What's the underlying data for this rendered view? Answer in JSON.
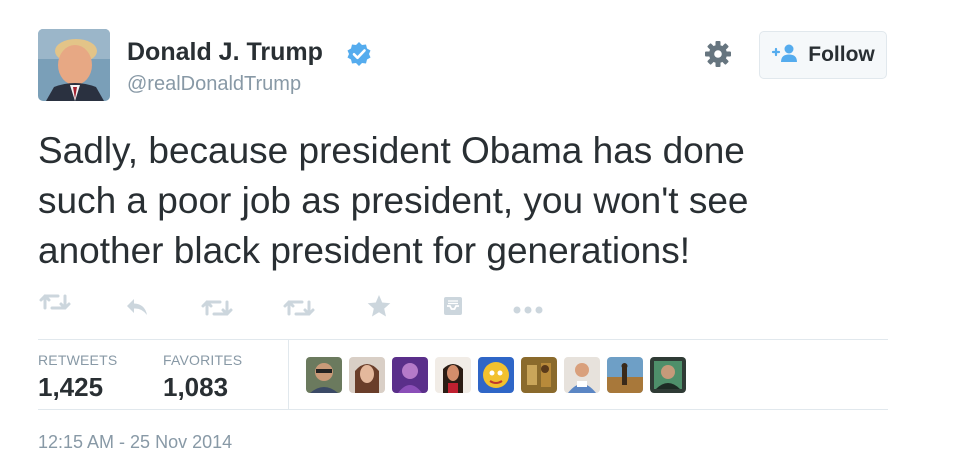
{
  "author": {
    "name": "Donald J. Trump",
    "handle": "@realDonaldTrump",
    "verified_icon": "verified-badge-icon"
  },
  "follow_button": {
    "label": "Follow",
    "icon": "follow-person-plus-icon"
  },
  "settings_icon": "gear-icon",
  "tweet": {
    "text": "Sadly, because president Obama has done\nsuch a poor job as president, you won't see\nanother black president for generations!"
  },
  "actions": [
    "retweet-icon",
    "reply-icon",
    "retweet-icon",
    "retweet-icon",
    "favorite-star-icon",
    "inbox-icon",
    "more-dots-icon"
  ],
  "stats": {
    "retweets_label": "RETWEETS",
    "retweets_value": "1,425",
    "favorites_label": "FAVORITES",
    "favorites_value": "1,083"
  },
  "engager_avatars_count": 9,
  "timestamp": "12:15 AM - 25 Nov 2014",
  "colors": {
    "text": "#292f33",
    "muted": "#8899a6",
    "verified": "#55acee",
    "divider": "#e1e8ed"
  }
}
